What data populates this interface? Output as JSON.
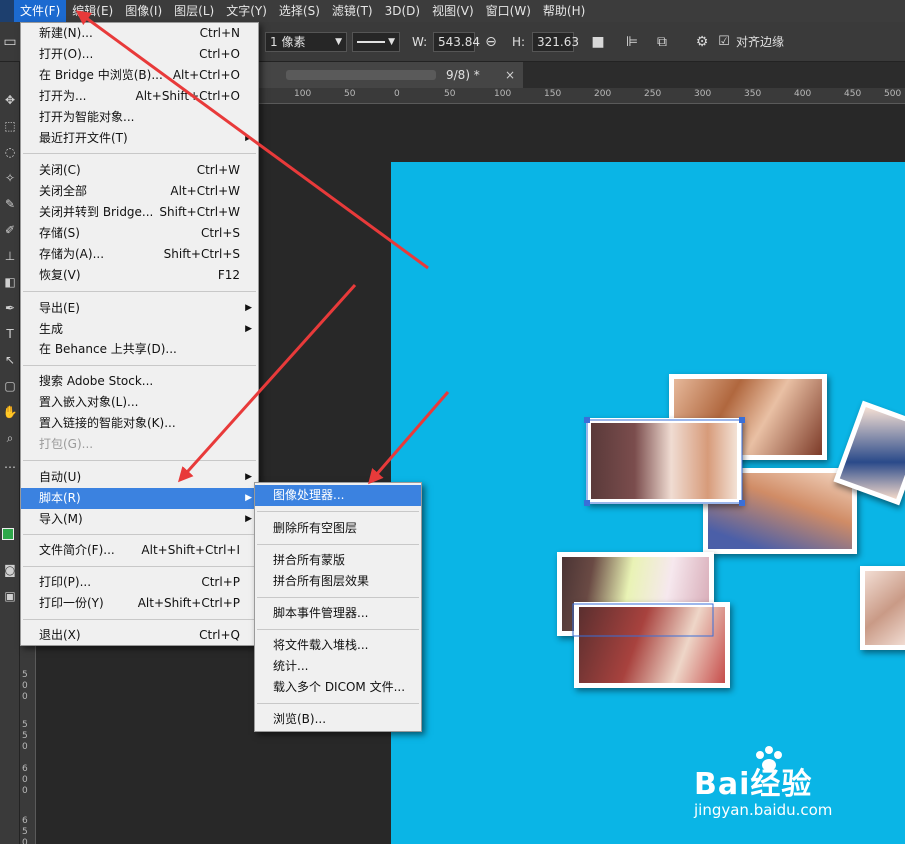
{
  "menubar": {
    "items": [
      {
        "label": "文件(F)"
      },
      {
        "label": "编辑(E)"
      },
      {
        "label": "图像(I)"
      },
      {
        "label": "图层(L)"
      },
      {
        "label": "文字(Y)"
      },
      {
        "label": "选择(S)"
      },
      {
        "label": "滤镜(T)"
      },
      {
        "label": "3D(D)"
      },
      {
        "label": "视图(V)"
      },
      {
        "label": "窗口(W)"
      },
      {
        "label": "帮助(H)"
      }
    ]
  },
  "options": {
    "stroke_width": "1 像素",
    "w_label": "W:",
    "w_value": "543.84",
    "h_label": "H:",
    "h_value": "321.63",
    "align_edges_label": "对齐边缘"
  },
  "tab": {
    "name": "9/8) *",
    "close": "×"
  },
  "ruler": {
    "h_ticks": [
      "100",
      "50",
      "0",
      "50",
      "100",
      "150",
      "200",
      "250",
      "300",
      "350",
      "400",
      "450",
      "500",
      "5"
    ],
    "v_ticks": [
      "500",
      "550",
      "600",
      "650"
    ]
  },
  "file_menu": {
    "items": [
      {
        "label": "新建(N)...",
        "shortcut": "Ctrl+N"
      },
      {
        "label": "打开(O)...",
        "shortcut": "Ctrl+O"
      },
      {
        "label": "在 Bridge 中浏览(B)...",
        "shortcut": "Alt+Ctrl+O"
      },
      {
        "label": "打开为...",
        "shortcut": "Alt+Shift+Ctrl+O"
      },
      {
        "label": "打开为智能对象...",
        "shortcut": ""
      },
      {
        "label": "最近打开文件(T)",
        "shortcut": ""
      },
      {
        "label": "关闭(C)",
        "shortcut": "Ctrl+W"
      },
      {
        "label": "关闭全部",
        "shortcut": "Alt+Ctrl+W"
      },
      {
        "label": "关闭并转到 Bridge...",
        "shortcut": "Shift+Ctrl+W"
      },
      {
        "label": "存储(S)",
        "shortcut": "Ctrl+S"
      },
      {
        "label": "存储为(A)...",
        "shortcut": "Shift+Ctrl+S"
      },
      {
        "label": "恢复(V)",
        "shortcut": "F12"
      },
      {
        "label": "导出(E)",
        "shortcut": ""
      },
      {
        "label": "生成",
        "shortcut": ""
      },
      {
        "label": "在 Behance 上共享(D)...",
        "shortcut": ""
      },
      {
        "label": "搜索 Adobe Stock...",
        "shortcut": ""
      },
      {
        "label": "置入嵌入对象(L)...",
        "shortcut": ""
      },
      {
        "label": "置入链接的智能对象(K)...",
        "shortcut": ""
      },
      {
        "label": "打包(G)...",
        "shortcut": ""
      },
      {
        "label": "自动(U)",
        "shortcut": ""
      },
      {
        "label": "脚本(R)",
        "shortcut": ""
      },
      {
        "label": "导入(M)",
        "shortcut": ""
      },
      {
        "label": "文件简介(F)...",
        "shortcut": "Alt+Shift+Ctrl+I"
      },
      {
        "label": "打印(P)...",
        "shortcut": "Ctrl+P"
      },
      {
        "label": "打印一份(Y)",
        "shortcut": "Alt+Shift+Ctrl+P"
      },
      {
        "label": "退出(X)",
        "shortcut": "Ctrl+Q"
      }
    ]
  },
  "script_submenu": {
    "items": [
      {
        "label": "图像处理器..."
      },
      {
        "label": "删除所有空图层"
      },
      {
        "label": "拼合所有蒙版"
      },
      {
        "label": "拼合所有图层效果"
      },
      {
        "label": "脚本事件管理器..."
      },
      {
        "label": "将文件载入堆栈..."
      },
      {
        "label": "统计..."
      },
      {
        "label": "载入多个 DICOM 文件..."
      },
      {
        "label": "浏览(B)..."
      }
    ]
  },
  "watermark": {
    "brand": "Bai经验",
    "url": "jingyan.baidu.com"
  },
  "colors": {
    "canvas": "#0ab5e6",
    "highlight": "#3b82e0",
    "arrow": "#e83a3a"
  }
}
